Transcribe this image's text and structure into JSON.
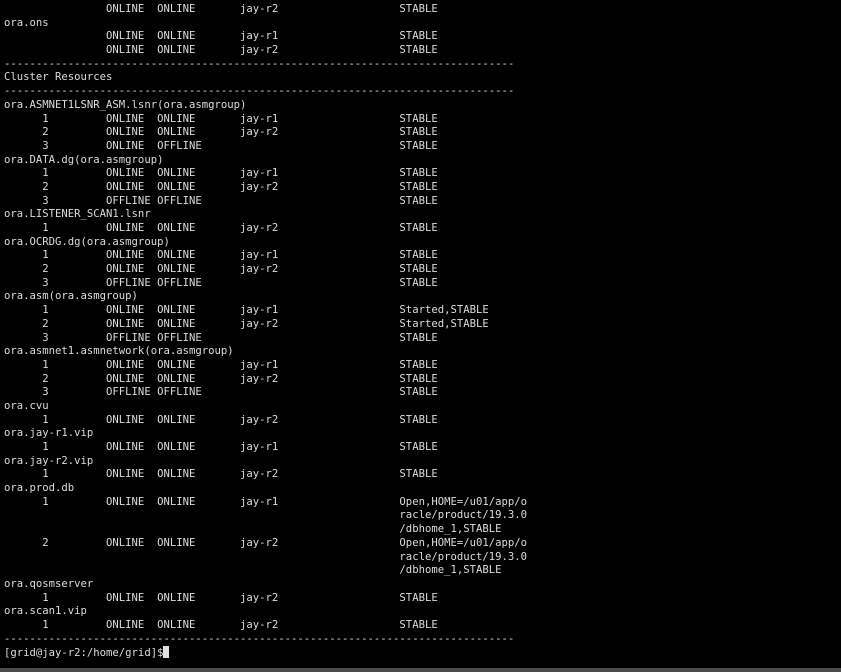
{
  "terminal": {
    "lines": [
      "                ONLINE  ONLINE       jay-r2                   STABLE",
      "ora.ons",
      "                ONLINE  ONLINE       jay-r1                   STABLE",
      "                ONLINE  ONLINE       jay-r2                   STABLE",
      "--------------------------------------------------------------------------------",
      "Cluster Resources",
      "--------------------------------------------------------------------------------",
      "ora.ASMNET1LSNR_ASM.lsnr(ora.asmgroup)",
      "      1         ONLINE  ONLINE       jay-r1                   STABLE",
      "      2         ONLINE  ONLINE       jay-r2                   STABLE",
      "      3         ONLINE  OFFLINE                               STABLE",
      "ora.DATA.dg(ora.asmgroup)",
      "      1         ONLINE  ONLINE       jay-r1                   STABLE",
      "      2         ONLINE  ONLINE       jay-r2                   STABLE",
      "      3         OFFLINE OFFLINE                               STABLE",
      "ora.LISTENER_SCAN1.lsnr",
      "      1         ONLINE  ONLINE       jay-r2                   STABLE",
      "ora.OCRDG.dg(ora.asmgroup)",
      "      1         ONLINE  ONLINE       jay-r1                   STABLE",
      "      2         ONLINE  ONLINE       jay-r2                   STABLE",
      "      3         OFFLINE OFFLINE                               STABLE",
      "ora.asm(ora.asmgroup)",
      "      1         ONLINE  ONLINE       jay-r1                   Started,STABLE",
      "      2         ONLINE  ONLINE       jay-r2                   Started,STABLE",
      "      3         OFFLINE OFFLINE                               STABLE",
      "ora.asmnet1.asmnetwork(ora.asmgroup)",
      "      1         ONLINE  ONLINE       jay-r1                   STABLE",
      "      2         ONLINE  ONLINE       jay-r2                   STABLE",
      "      3         OFFLINE OFFLINE                               STABLE",
      "ora.cvu",
      "      1         ONLINE  ONLINE       jay-r2                   STABLE",
      "ora.jay-r1.vip",
      "      1         ONLINE  ONLINE       jay-r1                   STABLE",
      "ora.jay-r2.vip",
      "      1         ONLINE  ONLINE       jay-r2                   STABLE",
      "ora.prod.db",
      "      1         ONLINE  ONLINE       jay-r1                   Open,HOME=/u01/app/o",
      "                                                              racle/product/19.3.0",
      "                                                              /dbhome_1,STABLE",
      "      2         ONLINE  ONLINE       jay-r2                   Open,HOME=/u01/app/o",
      "                                                              racle/product/19.3.0",
      "                                                              /dbhome_1,STABLE",
      "ora.qosmserver",
      "      1         ONLINE  ONLINE       jay-r2                   STABLE",
      "ora.scan1.vip",
      "      1         ONLINE  ONLINE       jay-r2                   STABLE",
      "--------------------------------------------------------------------------------"
    ],
    "prompt": "[grid@jay-r2:/home/grid]$"
  }
}
